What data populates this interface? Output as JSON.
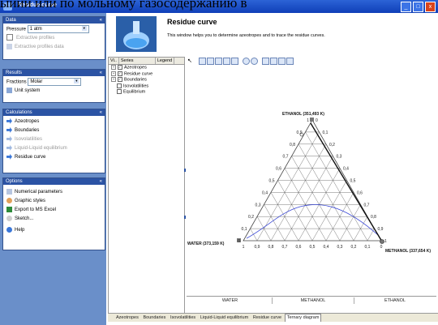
{
  "window": {
    "title": "Residue curve",
    "overlay_text": "ыйии или по мольному газосодержанию в"
  },
  "left": {
    "data": {
      "title": "Data",
      "pressure_label": "Pressure",
      "pressure_value": "1 atm",
      "extractive_profiles": "Extractive profiles",
      "extractive_profiles_data": "Extractive profiles data"
    },
    "results": {
      "title": "Results",
      "fractions_label": "Fractions",
      "fractions_value": "Molar",
      "unit_system": "Unit system"
    },
    "calculations": {
      "title": "Calculations",
      "items": [
        "Azeotropes",
        "Boundaries",
        "Isovolatilities",
        "Liquid-Liquid equilibrium",
        "Residue curve"
      ]
    },
    "options": {
      "title": "Options",
      "items": [
        "Numerical parameters",
        "Graphic styles",
        "Export to MS Excel",
        "Sketch...",
        "Help"
      ]
    }
  },
  "header": {
    "title": "Residue curve",
    "description": "This window helps you to determine azeotropes and to trace the residue curves."
  },
  "tree": {
    "col_vi": "Vi..",
    "col_series": "Series",
    "col_legend": "Legend",
    "items": [
      "Azeotropes",
      "Residue curve",
      "Boundaries",
      "Isovolatilities",
      "Equilibrium"
    ]
  },
  "chart_data": {
    "type": "ternary",
    "vertex_top": "ETHANOL (351,493 K)",
    "vertex_left": "WATER (373,159 K)",
    "vertex_right": "METHANOL (337,654 K)",
    "ticks": [
      "0",
      "0,1",
      "0,2",
      "0,3",
      "0,4",
      "0,5",
      "0,6",
      "0,7",
      "0,8",
      "0,9",
      "1"
    ],
    "bottom_ticks": [
      "1",
      "0,9",
      "0,8",
      "0,7",
      "0,6",
      "0,5",
      "0,4",
      "0,3",
      "0,2",
      "0,1",
      "0"
    ]
  },
  "table": {
    "columns": [
      "WATER",
      "METHANOL",
      "ETHANOL"
    ]
  },
  "tabs": [
    "Azeotropes",
    "Boundaries",
    "Isovolatilities",
    "Liquid-Liquid equilibrium",
    "Residue curve",
    "Ternary diagram"
  ]
}
